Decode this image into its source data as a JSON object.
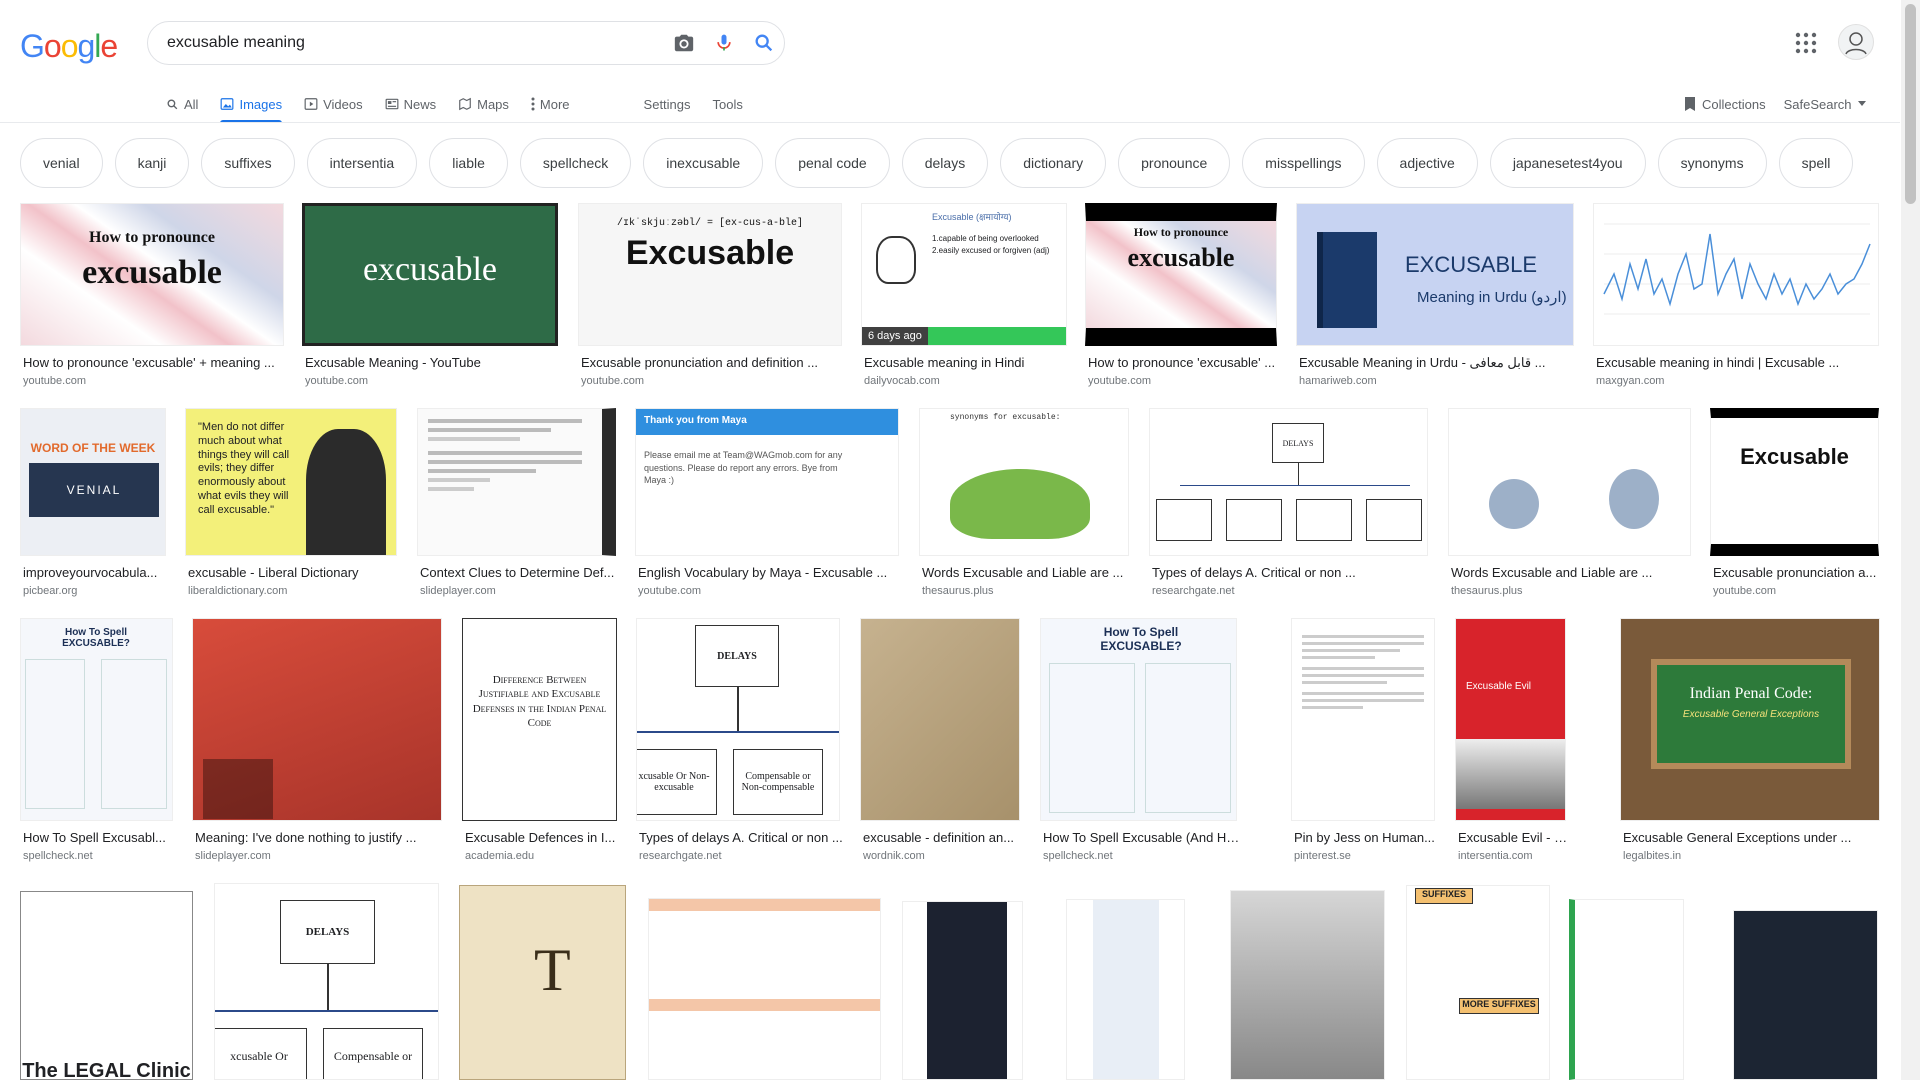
{
  "header": {
    "logo": [
      "G",
      "o",
      "o",
      "g",
      "l",
      "e"
    ],
    "logo_colors": [
      "#4285f4",
      "#ea4335",
      "#fbbc05",
      "#4285f4",
      "#34a853",
      "#ea4335"
    ],
    "query": "excusable meaning"
  },
  "tabs": [
    {
      "label": "All",
      "icon": "search-icon"
    },
    {
      "label": "Images",
      "icon": "image-icon"
    },
    {
      "label": "Videos",
      "icon": "video-icon"
    },
    {
      "label": "News",
      "icon": "news-icon"
    },
    {
      "label": "Maps",
      "icon": "map-icon"
    },
    {
      "label": "More",
      "icon": "more-icon"
    },
    {
      "label": "Settings"
    },
    {
      "label": "Tools"
    }
  ],
  "right_links": {
    "collections": "Collections",
    "safesearch": "SafeSearch"
  },
  "chips": [
    "venial",
    "kanji",
    "suffixes",
    "intersentia",
    "liable",
    "spellcheck",
    "inexcusable",
    "penal code",
    "delays",
    "dictionary",
    "pronounce",
    "misspellings",
    "adjective",
    "japanesetest4you",
    "synonyms",
    "spell"
  ],
  "results": [
    {
      "caption": "How to pronounce 'excusable' + meaning ...",
      "source": "youtube.com",
      "text1": "How to pronounce",
      "text2": "excusable"
    },
    {
      "caption": "Excusable Meaning - YouTube",
      "source": "youtube.com",
      "text1": "excusable"
    },
    {
      "caption": "Excusable pronunciation and definition ...",
      "source": "youtube.com",
      "text1": "/ɪkˈskjuːzəbl/ = [ex-cus-a-ble]",
      "text2": "Excusable"
    },
    {
      "caption": "Excusable meaning in Hindi",
      "source": "dailyvocab.com",
      "badge": "6 days ago",
      "text1": "Excusable (क्षमायोग्य)",
      "text2": "1.capable of being overlooked",
      "text3": "2.easily excused or forgiven (adj)"
    },
    {
      "caption": "How to pronounce 'excusable' ...",
      "source": "youtube.com",
      "text1": "How to pronounce",
      "text2": "excusable"
    },
    {
      "caption": "Excusable Meaning in Urdu - قابل معافی ...",
      "source": "hamariweb.com",
      "text1": "EXCUSABLE",
      "text2": "Meaning in Urdu (اردو)"
    },
    {
      "caption": "Excusable meaning in hindi | Excusable ...",
      "source": "maxgyan.com"
    },
    {
      "caption": "improveyourvocabula...",
      "source": "picbear.org",
      "text1": "WORD OF THE WEEK",
      "text2": "VENIAL"
    },
    {
      "caption": "excusable - Liberal Dictionary",
      "source": "liberaldictionary.com",
      "text1": "\"Men do not differ much about what things they will call evils; they differ enormously about what evils they will call excusable.\""
    },
    {
      "caption": "Context Clues to Determine Def...",
      "source": "slideplayer.com"
    },
    {
      "caption": "English Vocabulary by Maya - Excusable ...",
      "source": "youtube.com",
      "text1": "Thank you from Maya",
      "text2": "Please email me at Team@WAGmob.com for any questions. Please do report any errors. Bye from Maya :)"
    },
    {
      "caption": "Words Excusable and Liable are ...",
      "source": "thesaurus.plus",
      "text1": "synonyms for excusable:"
    },
    {
      "caption": "Types of delays A. Critical or non ...",
      "source": "researchgate.net",
      "text1": "DELAYS"
    },
    {
      "caption": "Words Excusable and Liable are ...",
      "source": "thesaurus.plus"
    },
    {
      "caption": "Excusable pronunciation a...",
      "source": "youtube.com",
      "text1": "Excusable"
    },
    {
      "caption": "How To Spell Excusabl...",
      "source": "spellcheck.net",
      "text1": "How To Spell EXCUSABLE?"
    },
    {
      "caption": "Meaning: I've done nothing to justify ...",
      "source": "slideplayer.com"
    },
    {
      "caption": "Excusable Defences in I...",
      "source": "academia.edu",
      "text1": "Difference Between Justifiable and Excusable Defenses in the Indian Penal Code"
    },
    {
      "caption": "Types of delays A. Critical or non ...",
      "source": "researchgate.net",
      "text1": "DELAYS",
      "text2": "xcusable Or Non-excusable",
      "text3": "Compensable or Non-compensable"
    },
    {
      "caption": "excusable - definition an...",
      "source": "wordnik.com"
    },
    {
      "caption": "How To Spell Excusable (And How To ...",
      "source": "spellcheck.net",
      "text1": "How To Spell EXCUSABLE?"
    },
    {
      "caption": "Pin by Jess on Human...",
      "source": "pinterest.se"
    },
    {
      "caption": "Excusable Evil - Inters...",
      "source": "intersentia.com",
      "text1": "Excusable Evil"
    },
    {
      "caption": "Excusable General Exceptions under ...",
      "source": "legalbites.in",
      "text1": "Indian Penal Code:",
      "text2": "Excusable General Exceptions"
    }
  ],
  "row4_texts": {
    "clinic": "The LEGAL Clinic",
    "delays": "DELAYS",
    "xcusable": "xcusable Or",
    "compensable": "Compensable or",
    "suffixes": "SUFFIXES",
    "more_suffixes": "MORE SUFFIXES"
  },
  "colors": {
    "accent": "#1a73e8",
    "muted": "#70757a"
  }
}
